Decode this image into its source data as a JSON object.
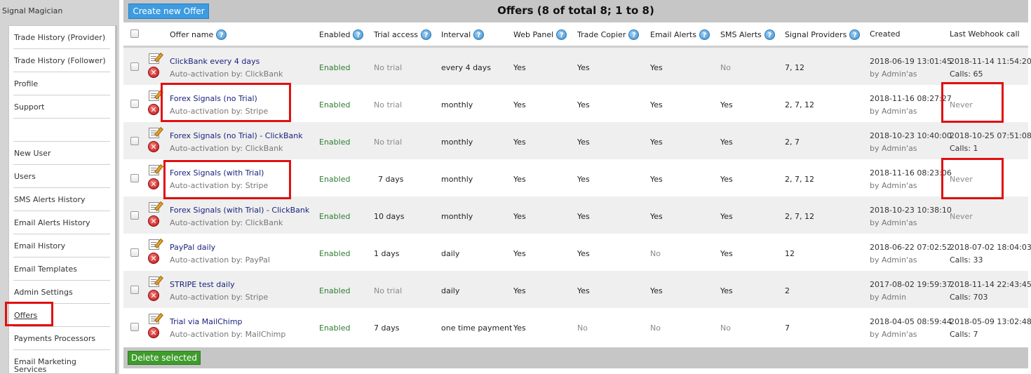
{
  "app": {
    "title": "Signal Magician"
  },
  "sidebar": {
    "items": [
      {
        "label": "Trade History (Provider)"
      },
      {
        "label": "Trade History (Follower)"
      },
      {
        "label": "Profile"
      },
      {
        "label": "Support"
      },
      {
        "label": ""
      },
      {
        "label": "New User"
      },
      {
        "label": "Users"
      },
      {
        "label": "SMS Alerts History"
      },
      {
        "label": "Email Alerts History"
      },
      {
        "label": "Email History"
      },
      {
        "label": "Email Templates"
      },
      {
        "label": "Admin Settings"
      },
      {
        "label": "Offers"
      },
      {
        "label": "Payments Processors"
      },
      {
        "label": "Email Marketing Services"
      }
    ],
    "active": "Offers"
  },
  "toolbar": {
    "create_label": "Create new Offer",
    "delete_label": "Delete selected"
  },
  "page": {
    "title": "Offers (8 of total 8; 1 to 8)"
  },
  "columns": {
    "offer_name": "Offer name",
    "enabled": "Enabled",
    "trial_access": "Trial access",
    "interval": "Interval",
    "web_panel": "Web Panel",
    "trade_copier": "Trade Copier",
    "email_alerts": "Email Alerts",
    "sms_alerts": "SMS Alerts",
    "signal_providers": "Signal Providers",
    "created": "Created",
    "last_webhook": "Last Webhook call"
  },
  "help_glyph": "?",
  "delete_glyph": "✕",
  "rows": [
    {
      "name": "ClickBank every 4 days",
      "activation": "Auto-activation by: ClickBank",
      "enabled": "Enabled",
      "trial": "No trial",
      "interval": "every 4 days",
      "web_panel": "Yes",
      "trade_copier": "Yes",
      "email_alerts": "Yes",
      "sms_alerts": "No",
      "providers": "7, 12",
      "created": "2018-06-19 13:01:45",
      "created_by": "by Admin'as",
      "webhook": "2018-11-14 11:54:20",
      "calls": "Calls: 65"
    },
    {
      "name": "Forex Signals (no Trial)",
      "activation": "Auto-activation by: Stripe",
      "enabled": "Enabled",
      "trial": "No trial",
      "interval": "monthly",
      "web_panel": "Yes",
      "trade_copier": "Yes",
      "email_alerts": "Yes",
      "sms_alerts": "Yes",
      "providers": "2, 7, 12",
      "created": "2018-11-16 08:27:27",
      "created_by": "by Admin'as",
      "webhook": "Never",
      "calls": ""
    },
    {
      "name": "Forex Signals (no Trial) - ClickBank",
      "activation": "Auto-activation by: ClickBank",
      "enabled": "Enabled",
      "trial": "No trial",
      "interval": "monthly",
      "web_panel": "Yes",
      "trade_copier": "Yes",
      "email_alerts": "Yes",
      "sms_alerts": "Yes",
      "providers": "2, 7",
      "created": "2018-10-23 10:40:00",
      "created_by": "by Admin'as",
      "webhook": "2018-10-25 07:51:08",
      "calls": "Calls: 1"
    },
    {
      "name": "Forex Signals (with Trial)",
      "activation": "Auto-activation by: Stripe",
      "enabled": "Enabled",
      "trial": "7 days",
      "interval": "monthly",
      "web_panel": "Yes",
      "trade_copier": "Yes",
      "email_alerts": "Yes",
      "sms_alerts": "Yes",
      "providers": "2, 7, 12",
      "created": "2018-11-16 08:23:06",
      "created_by": "by Admin'as",
      "webhook": "Never",
      "calls": ""
    },
    {
      "name": "Forex Signals (with Trial) - ClickBank",
      "activation": "Auto-activation by: ClickBank",
      "enabled": "Enabled",
      "trial": "10 days",
      "interval": "monthly",
      "web_panel": "Yes",
      "trade_copier": "Yes",
      "email_alerts": "Yes",
      "sms_alerts": "Yes",
      "providers": "2, 7, 12",
      "created": "2018-10-23 10:38:10",
      "created_by": "by Admin'as",
      "webhook": "Never",
      "calls": ""
    },
    {
      "name": "PayPal daily",
      "activation": "Auto-activation by: PayPal",
      "enabled": "Enabled",
      "trial": "1 days",
      "interval": "daily",
      "web_panel": "Yes",
      "trade_copier": "Yes",
      "email_alerts": "No",
      "sms_alerts": "Yes",
      "providers": "12",
      "created": "2018-06-22 07:02:52",
      "created_by": "by Admin'as",
      "webhook": "2018-07-02 18:04:03",
      "calls": "Calls: 33"
    },
    {
      "name": "STRIPE test daily",
      "activation": "Auto-activation by: Stripe",
      "enabled": "Enabled",
      "trial": "No trial",
      "interval": "daily",
      "web_panel": "Yes",
      "trade_copier": "Yes",
      "email_alerts": "Yes",
      "sms_alerts": "Yes",
      "providers": "2",
      "created": "2017-08-02 19:59:37",
      "created_by": "by Admin",
      "webhook": "2018-11-14 22:43:45",
      "calls": "Calls: 703"
    },
    {
      "name": "Trial via MailChimp",
      "activation": "Auto-activation by: MailChimp",
      "enabled": "Enabled",
      "trial": "7 days",
      "interval": "one time payment",
      "web_panel": "Yes",
      "trade_copier": "No",
      "email_alerts": "No",
      "sms_alerts": "No",
      "providers": "7",
      "created": "2018-04-05 08:59:44",
      "created_by": "by Admin'as",
      "webhook": "2018-05-09 13:02:48",
      "calls": "Calls: 7"
    }
  ],
  "colors": {
    "accent_blue": "#3d9be0",
    "delete_green": "#3e9c2c",
    "enabled_green": "#2e7d32",
    "highlight_red": "#e01010",
    "link_navy": "#1a237e"
  }
}
